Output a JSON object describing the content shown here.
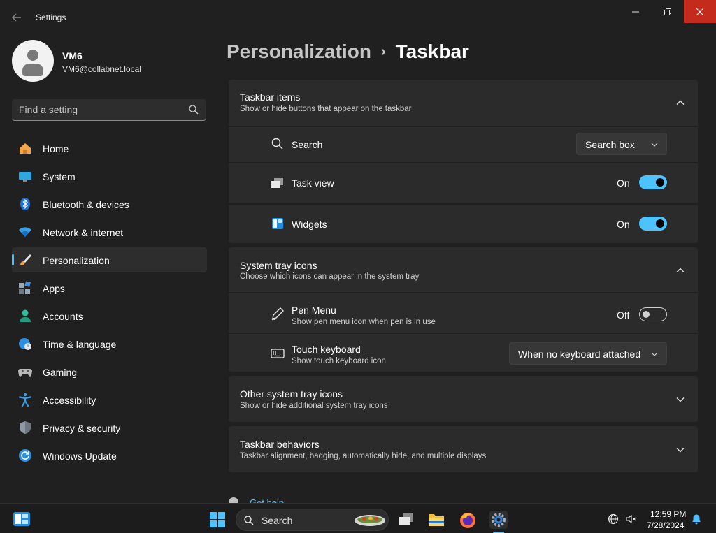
{
  "window": {
    "title": "Settings",
    "minimize_icon": "minimize-icon",
    "maximize_icon": "restore-icon",
    "close_icon": "close-icon",
    "close_color": "#c42b1c"
  },
  "profile": {
    "name": "VM6",
    "email": "VM6@collabnet.local"
  },
  "search": {
    "placeholder": "Find a setting"
  },
  "sidebar": {
    "items": [
      {
        "label": "Home",
        "icon": "home-icon"
      },
      {
        "label": "System",
        "icon": "display-icon"
      },
      {
        "label": "Bluetooth & devices",
        "icon": "bluetooth-icon"
      },
      {
        "label": "Network & internet",
        "icon": "wifi-icon"
      },
      {
        "label": "Personalization",
        "icon": "brush-icon",
        "active": true
      },
      {
        "label": "Apps",
        "icon": "apps-icon"
      },
      {
        "label": "Accounts",
        "icon": "person-icon"
      },
      {
        "label": "Time & language",
        "icon": "globe-clock-icon"
      },
      {
        "label": "Gaming",
        "icon": "gamepad-icon"
      },
      {
        "label": "Accessibility",
        "icon": "accessibility-icon"
      },
      {
        "label": "Privacy & security",
        "icon": "shield-icon"
      },
      {
        "label": "Windows Update",
        "icon": "update-icon"
      }
    ]
  },
  "breadcrumb": {
    "parent": "Personalization",
    "separator": "›",
    "current": "Taskbar"
  },
  "sections": {
    "taskbar_items": {
      "title": "Taskbar items",
      "subtitle": "Show or hide buttons that appear on the taskbar",
      "expanded": true,
      "rows": {
        "search": {
          "label": "Search",
          "value": "Search box"
        },
        "task_view": {
          "label": "Task view",
          "state": "On"
        },
        "widgets": {
          "label": "Widgets",
          "state": "On"
        }
      }
    },
    "system_tray": {
      "title": "System tray icons",
      "subtitle": "Choose which icons can appear in the system tray",
      "expanded": true,
      "rows": {
        "pen_menu": {
          "label": "Pen Menu",
          "sub": "Show pen menu icon when pen is in use",
          "state": "Off"
        },
        "touch_keyboard": {
          "label": "Touch keyboard",
          "sub": "Show touch keyboard icon",
          "value": "When no keyboard attached"
        }
      }
    },
    "other_tray": {
      "title": "Other system tray icons",
      "subtitle": "Show or hide additional system tray icons",
      "expanded": false
    },
    "behaviors": {
      "title": "Taskbar behaviors",
      "subtitle": "Taskbar alignment, badging, automatically hide, and multiple displays",
      "expanded": false
    }
  },
  "help": {
    "label": "Get help"
  },
  "taskbar": {
    "search_label": "Search",
    "time": "12:59 PM",
    "date": "7/28/2024",
    "accent": "#4cc2ff"
  }
}
